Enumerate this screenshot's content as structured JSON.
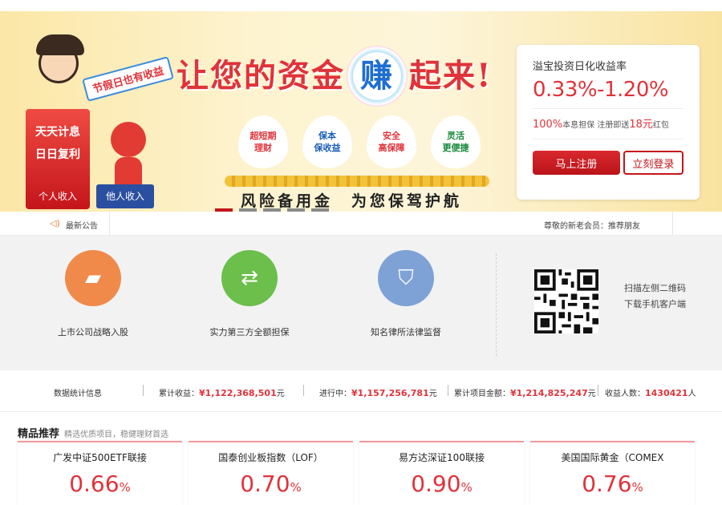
{
  "banner": {
    "slogan_a": "让您的资金",
    "slogan_b": "赚",
    "slogan_c": "起来!",
    "holiday": "节假日也有收益",
    "box_l1": "天天计息",
    "box_l2": "日日复利",
    "box_l3": "个人收入",
    "blue_box": "他人收入",
    "drops": [
      {
        "l1": "超短期",
        "l2": "理财",
        "color": "#f0a31a"
      },
      {
        "l1": "保本",
        "l2": "保收益",
        "color": "#2b8fd6"
      },
      {
        "l1": "安全",
        "l2": "高保障",
        "color": "#e7473f"
      },
      {
        "l1": "灵活",
        "l2": "更便捷",
        "color": "#2aa24a"
      }
    ],
    "risk": "风险备用金　为您保驾护航",
    "card": {
      "title": "溢宝投资日化收益率",
      "rate": "0.33%-1.20%",
      "sub_pct": "100%",
      "sub_a": "本息担保 注册即送",
      "sub_amt": "18元",
      "sub_b": "红包",
      "register": "马上注册",
      "login": "立刻登录"
    }
  },
  "notice": {
    "label": "最新公告",
    "message": "尊敬的新老会员：推荐朋友"
  },
  "features": [
    {
      "caption": "上市公司战略入股",
      "icon": "gold-bars-icon",
      "color": "#f08a4b"
    },
    {
      "caption": "实力第三方全额担保",
      "icon": "handshake-icon",
      "color": "#6bbf4a"
    },
    {
      "caption": "知名律所法律监督",
      "icon": "shield-icon",
      "color": "#7ea2d6"
    }
  ],
  "qr": {
    "line1": "扫描左侧二维码",
    "line2": "下载手机客户端"
  },
  "stats": {
    "label": "数据统计信息",
    "income_label": "累计收益：",
    "income": "¥1,122,368,501",
    "ongoing_label": "进行中：",
    "ongoing": "¥1,157,256,781",
    "total_label": "累计项目金额：",
    "total": "¥1,214,825,247",
    "users_label": "收益人数：",
    "users": "1430421",
    "unit_yuan": "元",
    "unit_ren": "人"
  },
  "recommend": {
    "title": "精品推荐",
    "subtitle": "精选优质项目，稳健理财首选"
  },
  "products": [
    {
      "name": "广发中证500ETF联接",
      "rate": "0.66",
      "pct": "%"
    },
    {
      "name": "国泰创业板指数（LOF）",
      "rate": "0.70",
      "pct": "%"
    },
    {
      "name": "易方达深证100联接",
      "rate": "0.90",
      "pct": "%"
    },
    {
      "name": "美国国际黄金（COMEX",
      "rate": "0.76",
      "pct": "%"
    }
  ]
}
